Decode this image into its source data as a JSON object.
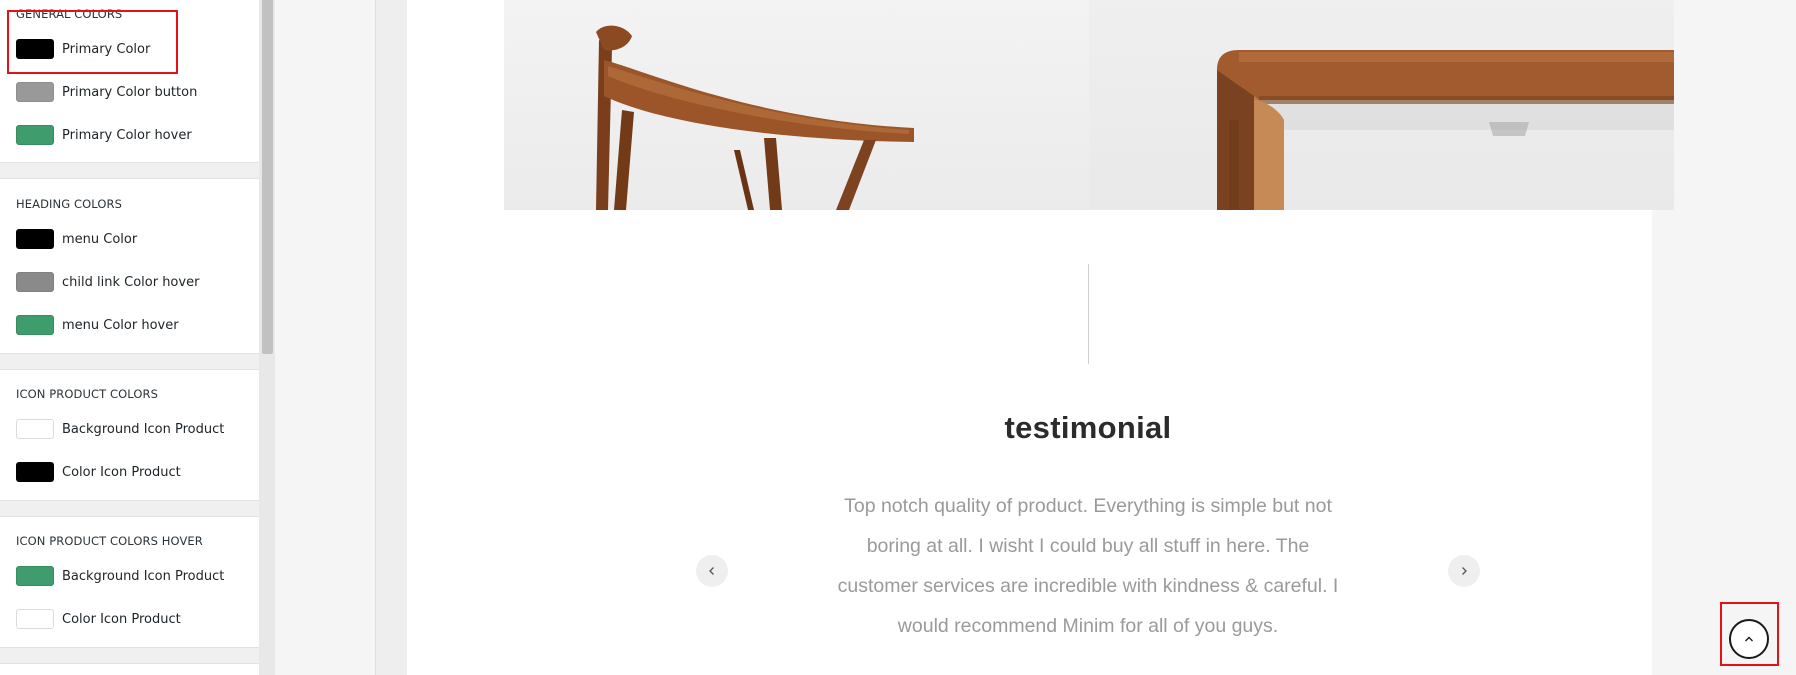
{
  "sidebar": {
    "sections": [
      {
        "title": "GENERAL COLORS",
        "items": [
          {
            "label": "Primary Color",
            "color": "#000000"
          },
          {
            "label": "Primary Color button",
            "color": "#999999"
          },
          {
            "label": "Primary Color hover",
            "color": "#3f9c6c"
          }
        ]
      },
      {
        "title": "HEADING COLORS",
        "items": [
          {
            "label": "menu Color",
            "color": "#000000"
          },
          {
            "label": "child link Color hover",
            "color": "#8a8a8a"
          },
          {
            "label": "menu Color hover",
            "color": "#3f9c6c"
          }
        ]
      },
      {
        "title": "ICON PRODUCT COLORS",
        "items": [
          {
            "label": "Background Icon Product",
            "color": "#ffffff"
          },
          {
            "label": "Color Icon Product",
            "color": "#000000"
          }
        ]
      },
      {
        "title": "ICON PRODUCT COLORS HOVER",
        "items": [
          {
            "label": "Background Icon Product",
            "color": "#3f9c6c"
          },
          {
            "label": "Color Icon Product",
            "color": "#ffffff"
          }
        ]
      }
    ]
  },
  "preview": {
    "hero_images": [
      "wooden-chair-photo",
      "wooden-table-corner-photo"
    ],
    "testimonial": {
      "title": "testimonial",
      "quote_lines": [
        "Top notch quality of product. Everything is simple but not",
        "boring at all. I wisht I could buy all stuff in here. The",
        "customer services are incredible with kindness & careful. I",
        "would recommend Minim for all of you guys."
      ],
      "prev_icon": "chevron-left-icon",
      "next_icon": "chevron-right-icon"
    },
    "scroll_top_icon": "chevron-up-icon"
  },
  "colors": {
    "highlight": "#e5101a",
    "accent_green": "#3f9c6c"
  }
}
